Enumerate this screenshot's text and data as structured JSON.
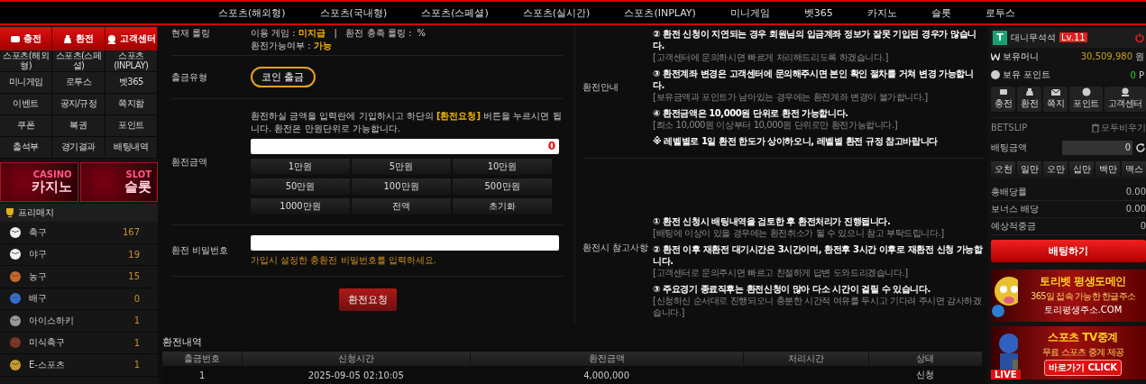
{
  "top_nav": {
    "items": [
      "스포츠(해외형)",
      "스포츠(국내형)",
      "스포츠(스페셜)",
      "스포츠(실시간)",
      "스포츠(INPLAY)",
      "미니게임",
      "벳365",
      "카지노",
      "슬롯",
      "로투스"
    ]
  },
  "sidebar": {
    "quick_buttons": [
      "충전",
      "환전",
      "고객센터"
    ],
    "menu": [
      "스포츠(해외형)",
      "스포츠(스페셜)",
      "스포츠(INPLAY)",
      "미니게임",
      "로투스",
      "벳365",
      "이벤트",
      "공지/규정",
      "쪽지함",
      "쿠폰",
      "복권",
      "포인트",
      "출석부",
      "경기결과",
      "배팅내역"
    ],
    "banners": [
      {
        "title": "CASINO",
        "subtitle": "카지노"
      },
      {
        "title": "SLOT",
        "subtitle": "슬롯"
      }
    ],
    "prematch": {
      "title": "프리매치",
      "sports": [
        {
          "name": "축구",
          "count": "167"
        },
        {
          "name": "야구",
          "count": "19"
        },
        {
          "name": "농구",
          "count": "15"
        },
        {
          "name": "배구",
          "count": "0"
        },
        {
          "name": "아이스하키",
          "count": "1"
        },
        {
          "name": "미식축구",
          "count": "1"
        },
        {
          "name": "E-스포츠",
          "count": "1"
        }
      ]
    }
  },
  "withdraw_form": {
    "rolling": {
      "label": "현재 롤링",
      "game_label": "이용 게임 :",
      "game_value": "미지급",
      "separator": "|",
      "rolling_label": "환전 충족 롤링 :",
      "rolling_value": "%",
      "available_label": "환전가능여부 :",
      "available_value": "가능"
    },
    "type": {
      "label": "출금유형",
      "option": "코인 출금"
    },
    "amount": {
      "label": "환전금액",
      "notice": "환전하실 금액을 입력란에 기입하시고 하단의 **[환전요청]** 버튼을 누르시면 됩니다. 환전은 만원단위로 가능합니다.",
      "value": "0",
      "chips": [
        "1만원",
        "5만원",
        "10만원",
        "50만원",
        "100만원",
        "500만원",
        "1000만원",
        "전액",
        "초기화"
      ]
    },
    "password": {
      "label": "환전 비밀번호",
      "hint": "가입시 설정한 충환전 비밀번호를 입력하세요."
    },
    "submit": "환전요청"
  },
  "info": {
    "sections": [
      {
        "label": "환전안내",
        "items": [
          {
            "title": "② 환전 신청이 지연되는 경우 회원님의 입금계좌 정보가 잘못 기입된 경우가 많습니다.",
            "note": "[고객센터에 문의하시면 빠르게 처리해드리도록 하겠습니다.]"
          },
          {
            "title": "③ 환전계좌 변경은 고객센터에 문의해주시면 본인 확인 절차를 거쳐 변경 가능합니다.",
            "note": "[보유금액과 포인트가 남아있는 경우에는 환전계좌 변경이 불가합니다.]"
          },
          {
            "title": "④ 환전금액은 10,000원 단위로 환전 가능합니다.",
            "note": "[최소 10,000원 이상부터 10,000원 단위로만 환전가능합니다.]"
          },
          {
            "title": "※ 레벨별로 1일 환전 한도가 상이하오니, 레벨별 환전 규정 참고바랍니다"
          }
        ]
      },
      {
        "label": "환전시 참고사항",
        "items": [
          {
            "title": "① 환전 신청시 배팅내역을 검토한 후 환전처리가 진행됩니다.",
            "note": "[배팅에 이상이 있을 경우에는 환전취소가 될 수 있으니 참고 부탁드립니다.]"
          },
          {
            "title": "② 환전 이후 재환전 대기시간은 3시간이며, 환전후 3시간 이후로 재환전 신청 가능합니다.",
            "note": "[고객센터로 문의주시면 빠르고 친절하게 답변 도와드리겠습니다.]"
          },
          {
            "title": "③ 주요경기 종료직후는 환전신청이 많아 다소 시간이 걸릴 수 있습니다.",
            "note": "[신청하신 순서대로 진행되오니 충분한 시간적 여유를 두시고 기다려 주시면 감사하겠습니다.]"
          }
        ]
      }
    ]
  },
  "history": {
    "title": "환전내역",
    "columns": [
      "출금번호",
      "신청시간",
      "환전금액",
      "처리시간",
      "상태"
    ],
    "rows": [
      {
        "number": "1",
        "requested": "2025-09-05 02:10:05",
        "amount": "4,000,000",
        "status": "신청"
      }
    ]
  },
  "user_panel": {
    "avatar": "T",
    "username": "대니무석석",
    "level": "Lv.11",
    "money_label": "보유머니",
    "money": "30,509,980",
    "money_unit": "원",
    "point_label": "보유 포인트",
    "points": "0",
    "point_unit": "P",
    "actions": [
      "충전",
      "환전",
      "쪽지",
      "포인트",
      "고객센터"
    ],
    "betslip": {
      "title": "BETSLIP",
      "clear": "모두비우기",
      "amount_label": "배팅금액",
      "amount": "0",
      "chips": [
        "오천",
        "일만",
        "오만",
        "십만",
        "백만",
        "맥스"
      ],
      "summary": [
        {
          "label": "총배당률",
          "value": "0.00"
        },
        {
          "label": "보너스 배당",
          "value": "0.00"
        },
        {
          "label": "예상적중금",
          "value": "0"
        }
      ],
      "submit": "배팅하기"
    }
  },
  "promo_banners": [
    {
      "title": "토리벳 평생도메인",
      "subtitle": "365일 접속 가능한 한글주소",
      "address": "토리평생주소.COM"
    },
    {
      "title": "스포츠 TV중계",
      "subtitle": "무료 스포츠 중계 제공",
      "cta": "바로가기 CLICK",
      "badge": "LIVE"
    }
  ]
}
